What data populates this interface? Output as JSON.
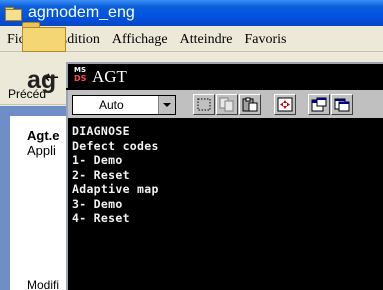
{
  "explorer": {
    "window_title": "agmodem_eng",
    "menu": [
      {
        "label": "Fichier"
      },
      {
        "label": "Edition"
      },
      {
        "label": "Affichage"
      },
      {
        "label": "Atteindre"
      },
      {
        "label": "Favoris"
      }
    ],
    "back_button_label": "Précéd",
    "folder_big_text": "ag",
    "file_name": "Agt.e",
    "file_type": "Appli",
    "file_modified": "Modifi"
  },
  "dos_window": {
    "logo_top": "MS",
    "logo_bottom": "DS",
    "title": "AGT",
    "font_select_value": "Auto",
    "toolbar_icons": [
      "mark-icon",
      "copy-icon",
      "paste-icon",
      "fullscreen-icon",
      "properties-icon",
      "background-icon"
    ],
    "console_lines": [
      "DIAGNOSE",
      "Defect codes",
      "1- Demo",
      "2- Reset",
      "Adaptive map",
      "3- Demo",
      "4- Reset"
    ]
  }
}
